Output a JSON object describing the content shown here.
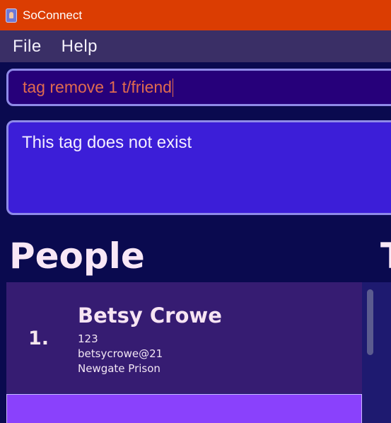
{
  "window": {
    "title": "SoConnect",
    "icon": "address-book-icon"
  },
  "menu": {
    "file": "File",
    "help": "Help"
  },
  "command": {
    "value": "tag remove 1 t/friend"
  },
  "result": {
    "message": "This tag does not exist"
  },
  "people": {
    "heading": "People",
    "persons": [
      {
        "index": "1.",
        "name": "Betsy Crowe",
        "phone": "123",
        "email": "betsycrowe@21",
        "address": "Newgate Prison"
      }
    ]
  },
  "tags": {
    "heading_partial": "T"
  },
  "colors": {
    "titlebar": "#db3d02",
    "menubar": "#3a2f66",
    "background": "#0a0a4f",
    "command_box": "#26007a",
    "result_box": "#3c1ed8",
    "selected_card": "#8a41fc"
  }
}
